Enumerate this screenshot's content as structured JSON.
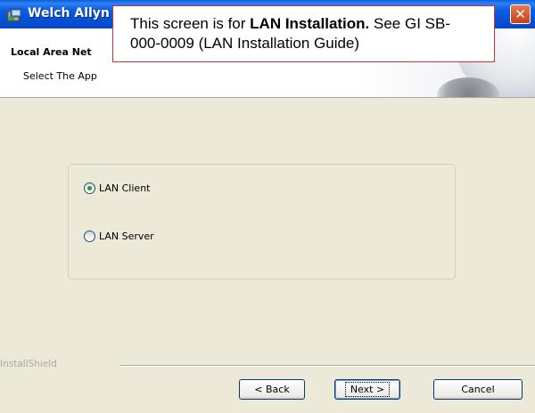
{
  "window": {
    "title": "Welch Allyn",
    "close_glyph": "✕"
  },
  "header": {
    "title": "Local Area Net",
    "subtitle": "Select The App"
  },
  "callout": {
    "prefix": "This screen is for ",
    "bold": "LAN Installation.",
    "suffix": " See GI SB-000-0009 (LAN Installation Guide)"
  },
  "options": [
    {
      "label": "LAN Client",
      "selected": true
    },
    {
      "label": "LAN Server",
      "selected": false
    }
  ],
  "footer": {
    "brand": "InstallShield",
    "back_label": "< Back",
    "next_label": "Next >",
    "cancel_label": "Cancel"
  },
  "icons": {
    "app": "installer-icon",
    "close": "close-icon"
  },
  "colors": {
    "titlebar": "#0552d8",
    "close_button": "#c74118",
    "callout_border": "#d63030",
    "radio_dot": "#21a121",
    "dialog_bg": "#ece9d8"
  }
}
